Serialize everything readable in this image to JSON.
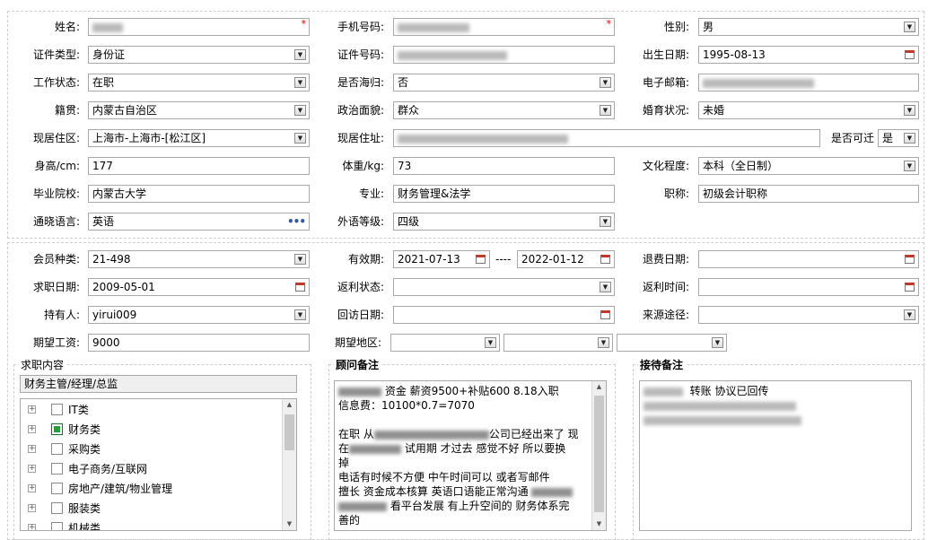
{
  "form": {
    "name_label": "姓名:",
    "mobile_label": "手机号码:",
    "gender_label": "性别:",
    "gender_value": "男",
    "idtype_label": "证件类型:",
    "idtype_value": "身份证",
    "idno_label": "证件号码:",
    "birth_label": "出生日期:",
    "birth_value": "1995-08-13",
    "workstatus_label": "工作状态:",
    "workstatus_value": "在职",
    "overseas_label": "是否海归:",
    "overseas_value": "否",
    "email_label": "电子邮箱:",
    "origin_label": "籍贯:",
    "origin_value": "内蒙古自治区",
    "political_label": "政治面貌:",
    "political_value": "群众",
    "marital_label": "婚育状况:",
    "marital_value": "未婚",
    "residence_area_label": "现居住区:",
    "residence_area_value": "上海市-上海市-[松江区]",
    "address_label": "现居住址:",
    "relocate_label": "是否可迁",
    "relocate_value": "是",
    "height_label": "身高/cm:",
    "height_value": "177",
    "weight_label": "体重/kg:",
    "weight_value": "73",
    "education_label": "文化程度:",
    "education_value": "本科（全日制）",
    "school_label": "毕业院校:",
    "school_value": "内蒙古大学",
    "major_label": "专业:",
    "major_value": "财务管理&法学",
    "title_label": "职称:",
    "title_value": "初级会计职称",
    "language_label": "通晓语言:",
    "language_value": "英语",
    "lang_level_label": "外语等级:",
    "lang_level_value": "四级"
  },
  "member": {
    "type_label": "会员种类:",
    "type_value": "21-498",
    "valid_label": "有效期:",
    "valid_from": "2021-07-13",
    "valid_sep": "----",
    "valid_to": "2022-01-12",
    "refund_date_label": "退费日期:",
    "job_date_label": "求职日期:",
    "job_date_value": "2009-05-01",
    "rebate_status_label": "返利状态:",
    "rebate_time_label": "返利时间:",
    "holder_label": "持有人:",
    "holder_value": "yirui009",
    "revisit_label": "回访日期:",
    "source_label": "来源途径:",
    "salary_label": "期望工资:",
    "salary_value": "9000",
    "region_label": "期望地区:"
  },
  "job_content": {
    "title": "求职内容",
    "selected": "财务主管/经理/总监",
    "tree": [
      {
        "label": "IT类",
        "checked": false
      },
      {
        "label": "财务类",
        "checked": true
      },
      {
        "label": "采购类",
        "checked": false
      },
      {
        "label": "电子商务/互联网",
        "checked": false
      },
      {
        "label": "房地产/建筑/物业管理",
        "checked": false
      },
      {
        "label": "服装类",
        "checked": false
      },
      {
        "label": "机械类",
        "checked": false
      }
    ]
  },
  "advisor_notes": {
    "title": "顾问备注",
    "l1": "资金 薪资9500+补贴600  8.18入职",
    "l2": "信息费：10100*0.7=7070",
    "l3a": "在职 从",
    "l3b": "公司已经出来了 现",
    "l4a": "在",
    "l4b": "试用期 才过去  感觉不好 所以要换",
    "l5": "掉",
    "l6": "电话有时候不方便  中午时间可以  或者写邮件",
    "l7": "擅长 资金成本核算  英语口语能正常沟通",
    "l8": "看平台发展  有上升空间的 财务体系完",
    "l9": "善的"
  },
  "reception_notes": {
    "title": "接待备注",
    "l1": "转账 协议已回传"
  },
  "colors": {
    "border": "#a9a9a9",
    "required": "#e00000",
    "checked": "#2a9d3a"
  }
}
